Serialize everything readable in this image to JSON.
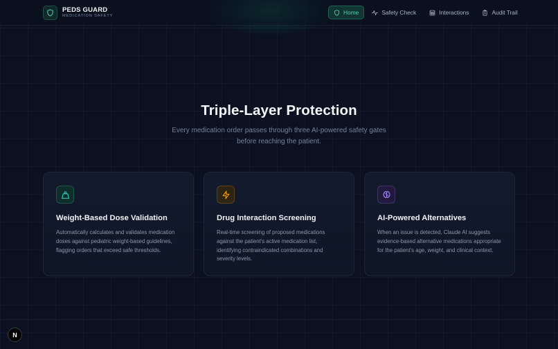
{
  "brand": {
    "title": "PEDS GUARD",
    "subtitle": "MEDICATION SAFETY",
    "icon": "shield-icon"
  },
  "nav": {
    "items": [
      {
        "label": "Home",
        "icon": "shield-icon",
        "active": true
      },
      {
        "label": "Safety Check",
        "icon": "activity-icon",
        "active": false
      },
      {
        "label": "Interactions",
        "icon": "table-icon",
        "active": false
      },
      {
        "label": "Audit Trail",
        "icon": "clipboard-icon",
        "active": false
      }
    ]
  },
  "hero": {
    "title": "Triple-Layer Protection",
    "subtitle": "Every medication order passes through three AI-powered safety gates before reaching the patient."
  },
  "cards": [
    {
      "title": "Weight-Based Dose Validation",
      "icon": "weight-icon",
      "accent": "#2dd4bf",
      "body": "Automatically calculates and validates medication doses against pediatric weight-based guidelines, flagging orders that exceed safe thresholds."
    },
    {
      "title": "Drug Interaction Screening",
      "icon": "lightning-icon",
      "accent": "#f59e0b",
      "body": "Real-time screening of proposed medications against the patient's active medication list, identifying contraindicated combinations and severity levels."
    },
    {
      "title": "AI-Powered Alternatives",
      "icon": "brain-icon",
      "accent": "#a78bfa",
      "body": "When an issue is detected, Claude AI suggests evidence-based alternative medications appropriate for the patient's age, weight, and clinical context."
    }
  ],
  "dev_badge": {
    "label": "N"
  },
  "colors": {
    "accent": "#4fd1b5",
    "background": "#0b1120"
  }
}
